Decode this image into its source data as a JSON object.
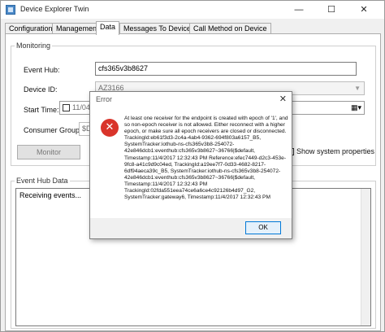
{
  "window": {
    "title": "Device Explorer Twin",
    "minimize_glyph": "—",
    "maximize_glyph": "☐",
    "close_glyph": "✕"
  },
  "tabs": [
    {
      "label": "Configuration"
    },
    {
      "label": "Management"
    },
    {
      "label": "Data"
    },
    {
      "label": "Messages To Device"
    },
    {
      "label": "Call Method on Device"
    }
  ],
  "monitoring": {
    "group_label": "Monitoring",
    "event_hub_label": "Event Hub:",
    "event_hub_value": "cfs365v3b8627",
    "device_id_label": "Device ID:",
    "device_id_value": "AZ3166",
    "start_time_label": "Start Time:",
    "start_time_value": "11/04/2",
    "consumer_group_label": "Consumer Group:",
    "consumer_group_value": "$D",
    "monitor_button": "Monitor",
    "show_system_properties": "Show system properties"
  },
  "event_hub_data": {
    "group_label": "Event Hub Data",
    "output_text": "Receiving events..."
  },
  "dialog": {
    "title": "Error",
    "close_glyph": "✕",
    "icon_glyph": "✕",
    "message": "At least one receiver for the endpoint is created with epoch of '1', and so non-epoch receiver is not allowed. Either reconnect with a higher epoch, or make sure all epoch receivers are closed or disconnected. TrackingId:eb61f3d3-2c4a-4ab4-9362-694f803a6157_B5, SystemTracker:iothub-ns-cfs365v3b8-254072-42e846dcb1:eventhub:cfs365v3b8627~36766|$default, Timestamp:11/4/2017 12:32:43 PM Reference:efec7449-d2c3-453e-9fc8-a41c9d9c04ed, TrackingId:a19ee7f7-0d33-4682-8217-6df94aeca39c_B5, SystemTracker:iothub-ns-cfs365v3b8-254072-42e846dcb1:eventhub:cfs365v3b8627~36766|$default, Timestamp:11/4/2017 12:32:43 PM TrackingId:02fda551eea74ce6a6ce4c92126b4d97_G2, SystemTracker:gateway6, Timestamp:11/4/2017 12:32:43 PM",
    "ok_button": "OK"
  }
}
